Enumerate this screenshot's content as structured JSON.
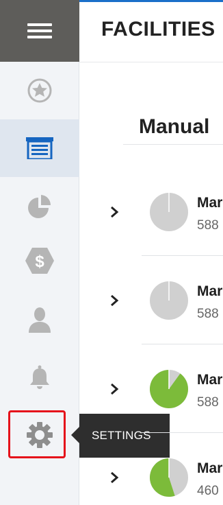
{
  "colors": {
    "accent": "#1b6fc9",
    "icon_gray": "#b5b5b5",
    "active_icon": "#1565c0",
    "pie_gray": "#d0d0d0",
    "pie_green": "#7cbb3a",
    "highlight_red": "#e5121b"
  },
  "header": {
    "title": "FACILITIES"
  },
  "sidebar": {
    "menu_icon": "hamburger-icon",
    "items": [
      {
        "icon": "star-icon",
        "active": false
      },
      {
        "icon": "facility-icon",
        "active": true
      },
      {
        "icon": "pie-chart-icon",
        "active": false
      },
      {
        "icon": "dollar-hex-icon",
        "active": false
      },
      {
        "icon": "user-icon",
        "active": false
      },
      {
        "icon": "bell-icon",
        "active": false
      },
      {
        "icon": "gear-icon",
        "active": false,
        "highlighted": true
      }
    ]
  },
  "tooltip": {
    "text": "SETTINGS"
  },
  "main": {
    "section_title": "Manual",
    "rows": [
      {
        "name": "Mar",
        "sub": "588",
        "progress": 0.0
      },
      {
        "name": "Mar",
        "sub": "588",
        "progress": 0.0
      },
      {
        "name": "Mar",
        "sub": "588",
        "progress": 0.9
      },
      {
        "name": "Mar",
        "sub": "460",
        "progress": 0.55
      }
    ]
  }
}
